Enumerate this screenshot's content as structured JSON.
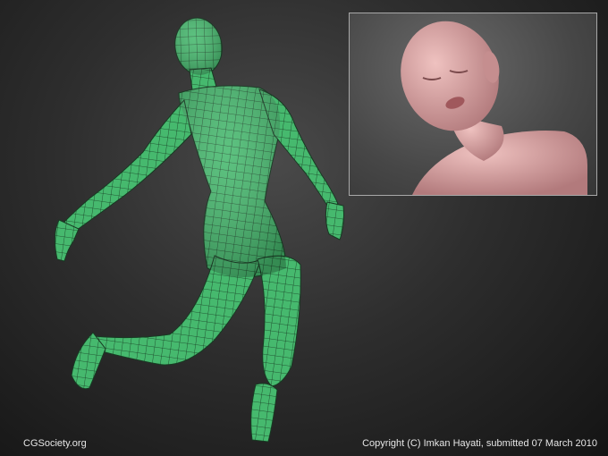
{
  "colors": {
    "mesh_fill": "#46b96e",
    "mesh_wire": "#173a22",
    "skin_fill": "#d9a3a3",
    "inset_border": "#a8a8a8",
    "caption_text": "#e6e6e6"
  },
  "footer": {
    "site_label": "CGSociety.org",
    "copyright": "Copyright (C) Imkan Hayati, submitted 07 March 2010"
  }
}
